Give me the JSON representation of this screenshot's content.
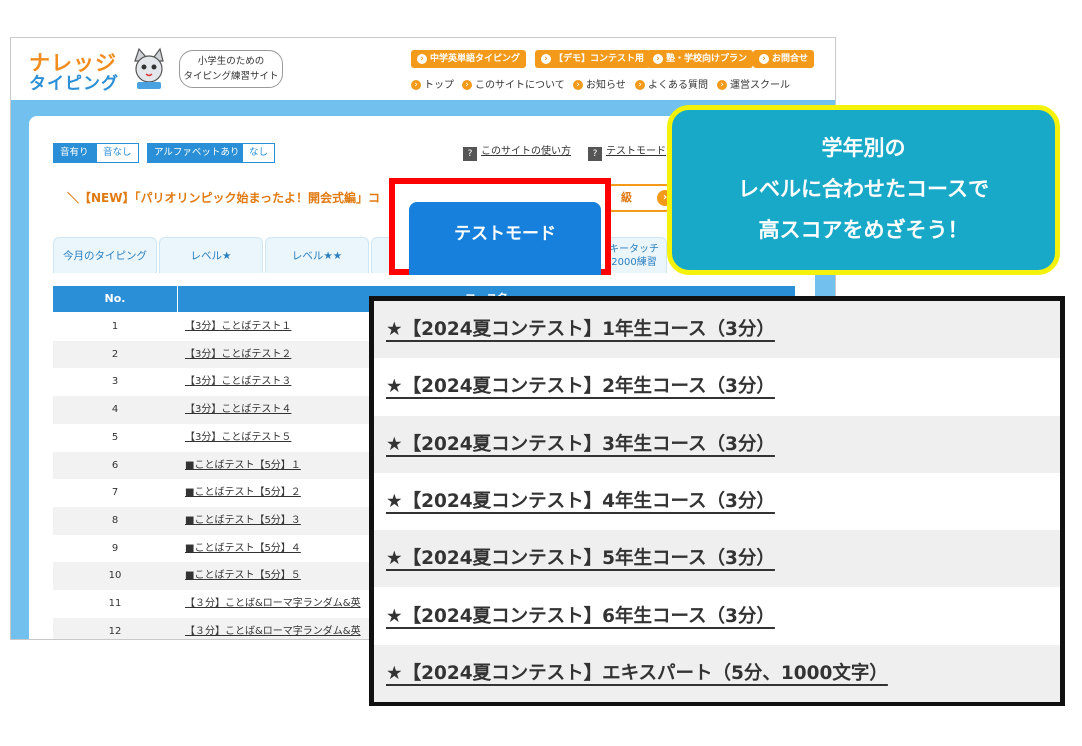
{
  "site": {
    "logo": {
      "line1": "ナレッジ",
      "line2": "タイピング"
    },
    "tagline": [
      "小学生のための",
      "タイピング練習サイト"
    ],
    "top_buttons": [
      "中学英単語タイピング",
      "【デモ】コンテスト用",
      "塾・学校向けプラン",
      "お問合せ"
    ],
    "nav_links": [
      "トップ",
      "このサイトについて",
      "お知らせ",
      "よくある質問",
      "運営スクール"
    ],
    "toggles": {
      "sound_on": "音有り",
      "sound_off": "音なし",
      "alpha_on": "アルファベットあり",
      "alpha_off": "なし"
    },
    "help_links": [
      "このサイトの使い方",
      "テストモード"
    ],
    "news": "＼【NEW】「パリオリンピック始まったよ！開会式編」コ",
    "level_pill": "級",
    "tabs": [
      "今月のタイピング",
      "レベル★",
      "レベル★★",
      "キータッチ\n2000練習"
    ],
    "table": {
      "header_no": "No.",
      "header_course": "コース名",
      "rows": [
        {
          "no": "1",
          "name": "【3分】ことばテスト１"
        },
        {
          "no": "2",
          "name": "【3分】ことばテスト２"
        },
        {
          "no": "3",
          "name": "【3分】ことばテスト３"
        },
        {
          "no": "4",
          "name": "【3分】ことばテスト４"
        },
        {
          "no": "5",
          "name": "【3分】ことばテスト５"
        },
        {
          "no": "6",
          "name": "■ことばテスト【5分】１"
        },
        {
          "no": "7",
          "name": "■ことばテスト【5分】２"
        },
        {
          "no": "8",
          "name": "■ことばテスト【5分】３"
        },
        {
          "no": "9",
          "name": "■ことばテスト【5分】４"
        },
        {
          "no": "10",
          "name": "■ことばテスト【5分】５"
        },
        {
          "no": "11",
          "name": "【３分】ことば&ローマ字ランダム&英"
        },
        {
          "no": "12",
          "name": "【３分】ことば&ローマ字ランダム&英"
        }
      ]
    }
  },
  "testmode_button": "テストモード",
  "callout": [
    "学年別の",
    "レベルに合わせたコースで",
    "高スコアをめざそう！"
  ],
  "zoom_courses": [
    "★【2024夏コンテスト】1年生コース（3分）",
    "★【2024夏コンテスト】2年生コース（3分）",
    "★【2024夏コンテスト】3年生コース（3分）",
    "★【2024夏コンテスト】4年生コース（3分）",
    "★【2024夏コンテスト】5年生コース（3分）",
    "★【2024夏コンテスト】6年生コース（3分）",
    "★【2024夏コンテスト】エキスパート（5分、1000文字）"
  ],
  "colors": {
    "accent_orange": "#f39a1b",
    "brand_blue": "#2a8fd6",
    "highlight_red": "#ff0000",
    "callout_teal": "#18a9c8",
    "callout_border": "#f4f20b"
  }
}
